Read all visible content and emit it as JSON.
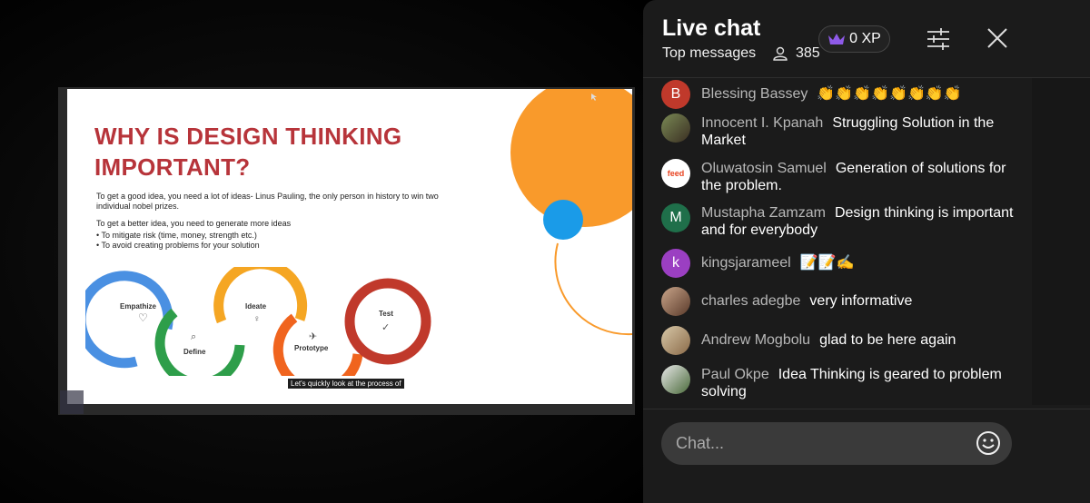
{
  "slide": {
    "title_line1": "WHY IS DESIGN THINKING",
    "title_line2": "IMPORTANT?",
    "para1": "To get a good idea, you need a lot of ideas- Linus Pauling, the only person in history to win two individual nobel prizes.",
    "para2": "To get a better idea, you need to generate more ideas",
    "bullets": [
      "To mitigate risk (time, money, strength etc.)",
      "To avoid creating problems for your solution"
    ],
    "steps": [
      "Empathize",
      "Define",
      "Ideate",
      "Prototype",
      "Test"
    ],
    "caption": "Let's quickly look at the process of",
    "colors": {
      "title": "#b7343a",
      "orange": "#f99a2b",
      "blue": "#1a9be8"
    }
  },
  "chat": {
    "title": "Live chat",
    "subtitle": "Top messages",
    "viewer_count": "385",
    "xp_label": "0 XP",
    "input_placeholder": "Chat...",
    "messages": [
      {
        "initial": "B",
        "avatar_color": "#c0392b",
        "author": "Blessing Bassey",
        "text": "👏👏👏👏👏👏👏👏"
      },
      {
        "initial": "",
        "avatar_color": "#6b5a3a",
        "author": "Innocent I. Kpanah",
        "text": "Struggling Solution in the Market"
      },
      {
        "initial": "feed",
        "avatar_color": "#ffffff",
        "author": "Oluwatosin Samuel",
        "text": "Generation of solutions for the problem."
      },
      {
        "initial": "M",
        "avatar_color": "#1f6f4a",
        "author": "Mustapha Zamzam",
        "text": "Design thinking is important and for everybody"
      },
      {
        "initial": "k",
        "avatar_color": "#9b3fc2",
        "author": "kingsjarameel",
        "text": "📝📝✍️"
      },
      {
        "initial": "",
        "avatar_color": "#8a6a55",
        "author": "charles adegbe",
        "text": "very informative"
      },
      {
        "initial": "",
        "avatar_color": "#a08a70",
        "author": "Andrew Mogbolu",
        "text": "glad to be here again"
      },
      {
        "initial": "",
        "avatar_color": "#5e7a5a",
        "author": "Paul Okpe",
        "text": "Idea Thinking is geared to problem solving"
      }
    ]
  }
}
